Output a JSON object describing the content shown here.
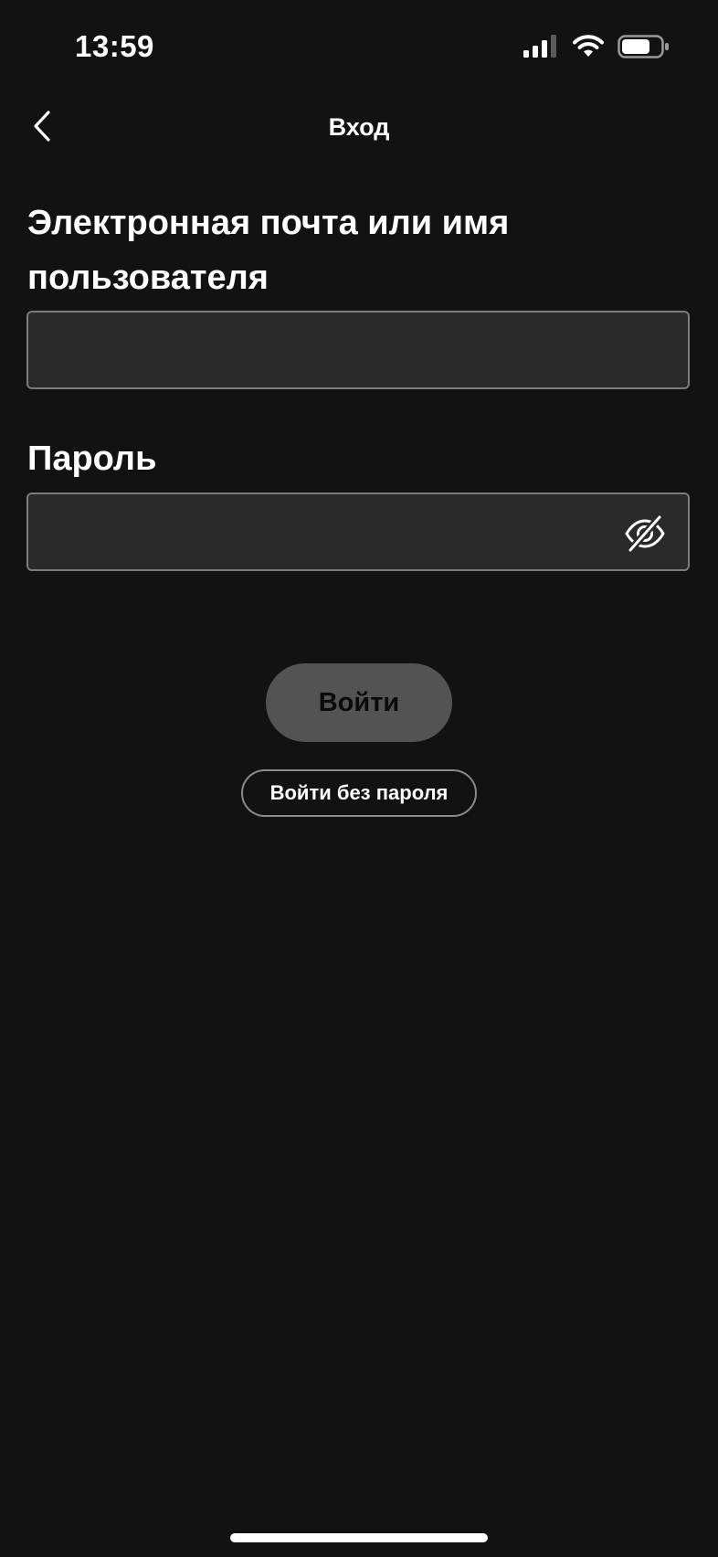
{
  "status_bar": {
    "time": "13:59",
    "icons": [
      "cellular-signal-icon",
      "wifi-icon",
      "battery-icon"
    ]
  },
  "nav": {
    "title": "Вход",
    "back_icon": "chevron-left-icon"
  },
  "form": {
    "email_label": "Электронная почта или имя пользователя",
    "email_value": "",
    "password_label": "Пароль",
    "password_value": "",
    "password_toggle_icon": "eye-slash-icon"
  },
  "actions": {
    "login_label": "Войти",
    "no_password_label": "Войти без пароля"
  },
  "colors": {
    "background": "#121212",
    "input_background": "#2a2a2a",
    "input_border": "#7c7c7c",
    "login_button_disabled": "#535353",
    "text": "#ffffff"
  }
}
